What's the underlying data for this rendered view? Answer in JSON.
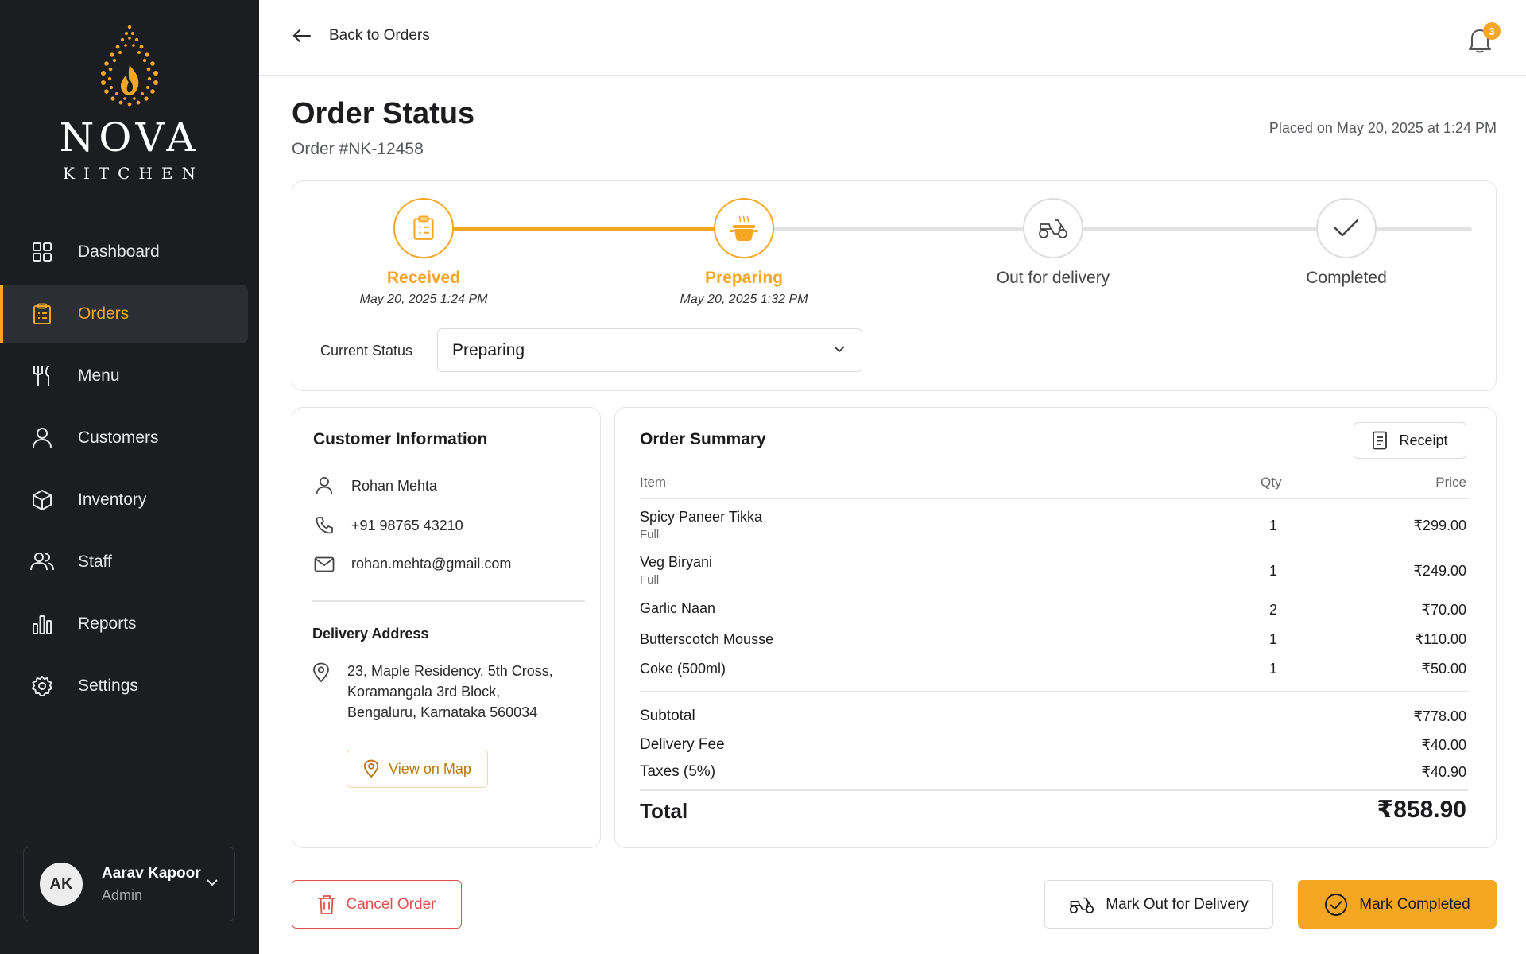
{
  "brand": {
    "name": "NOVA",
    "sub": "KITCHEN",
    "accent": "#f5a623",
    "sidebar_bg": "#1b1d21"
  },
  "sidebar": {
    "items": [
      {
        "label": "Dashboard",
        "icon": "grid-icon",
        "active": false
      },
      {
        "label": "Orders",
        "icon": "clipboard-icon",
        "active": true
      },
      {
        "label": "Menu",
        "icon": "fork-knife-icon",
        "active": false
      },
      {
        "label": "Customers",
        "icon": "user-icon",
        "active": false
      },
      {
        "label": "Inventory",
        "icon": "box-icon",
        "active": false
      },
      {
        "label": "Staff",
        "icon": "users-icon",
        "active": false
      },
      {
        "label": "Reports",
        "icon": "bar-chart-icon",
        "active": false
      },
      {
        "label": "Settings",
        "icon": "gear-icon",
        "active": false
      }
    ]
  },
  "user": {
    "initials": "AK",
    "name": "Aarav Kapoor",
    "role": "Admin"
  },
  "topbar": {
    "back_label": "Back to Orders",
    "notifications": "3"
  },
  "header": {
    "title": "Order Status",
    "order_no": "Order #NK-12458",
    "placed": "Placed on May 20, 2025 at 1:24 PM"
  },
  "status": {
    "steps": [
      {
        "label": "Received",
        "time": "May 20, 2025 1:24 PM",
        "done": true
      },
      {
        "label": "Preparing",
        "time": "May 20, 2025 1:32 PM",
        "done": true
      },
      {
        "label": "Out for delivery",
        "time": "",
        "done": false
      },
      {
        "label": "Completed",
        "time": "",
        "done": false
      }
    ],
    "current_label": "Current Status",
    "current_value": "Preparing"
  },
  "customer": {
    "title": "Customer Information",
    "name": "Rohan Mehta",
    "phone": "+91 98765 43210",
    "email": "rohan.mehta@gmail.com",
    "address_title": "Delivery Address",
    "address_lines": [
      "23, Maple Residency, 5th Cross,",
      "Koramangala 3rd Block,",
      "Bengaluru, Karnataka 560034"
    ],
    "map_button": "View on Map"
  },
  "summary": {
    "title": "Order Summary",
    "receipt_button": "Receipt",
    "columns": {
      "item": "Item",
      "qty": "Qty",
      "price": "Price"
    },
    "items": [
      {
        "name": "Spicy Paneer Tikka",
        "variant": "Full",
        "qty": "1",
        "price": "₹299.00"
      },
      {
        "name": "Veg Biryani",
        "variant": "Full",
        "qty": "1",
        "price": "₹249.00"
      },
      {
        "name": "Garlic Naan",
        "variant": "",
        "qty": "2",
        "price": "₹70.00"
      },
      {
        "name": "Butterscotch Mousse",
        "variant": "",
        "qty": "1",
        "price": "₹110.00"
      },
      {
        "name": "Coke (500ml)",
        "variant": "",
        "qty": "1",
        "price": "₹50.00"
      }
    ],
    "subtotal_label": "Subtotal",
    "subtotal": "₹778.00",
    "delivery_label": "Delivery Fee",
    "delivery": "₹40.00",
    "taxes_label": "Taxes (5%)",
    "taxes": "₹40.90",
    "total_label": "Total",
    "total": "₹858.90"
  },
  "actions": {
    "cancel": "Cancel Order",
    "out_for_delivery": "Mark Out for Delivery",
    "complete": "Mark Completed"
  }
}
